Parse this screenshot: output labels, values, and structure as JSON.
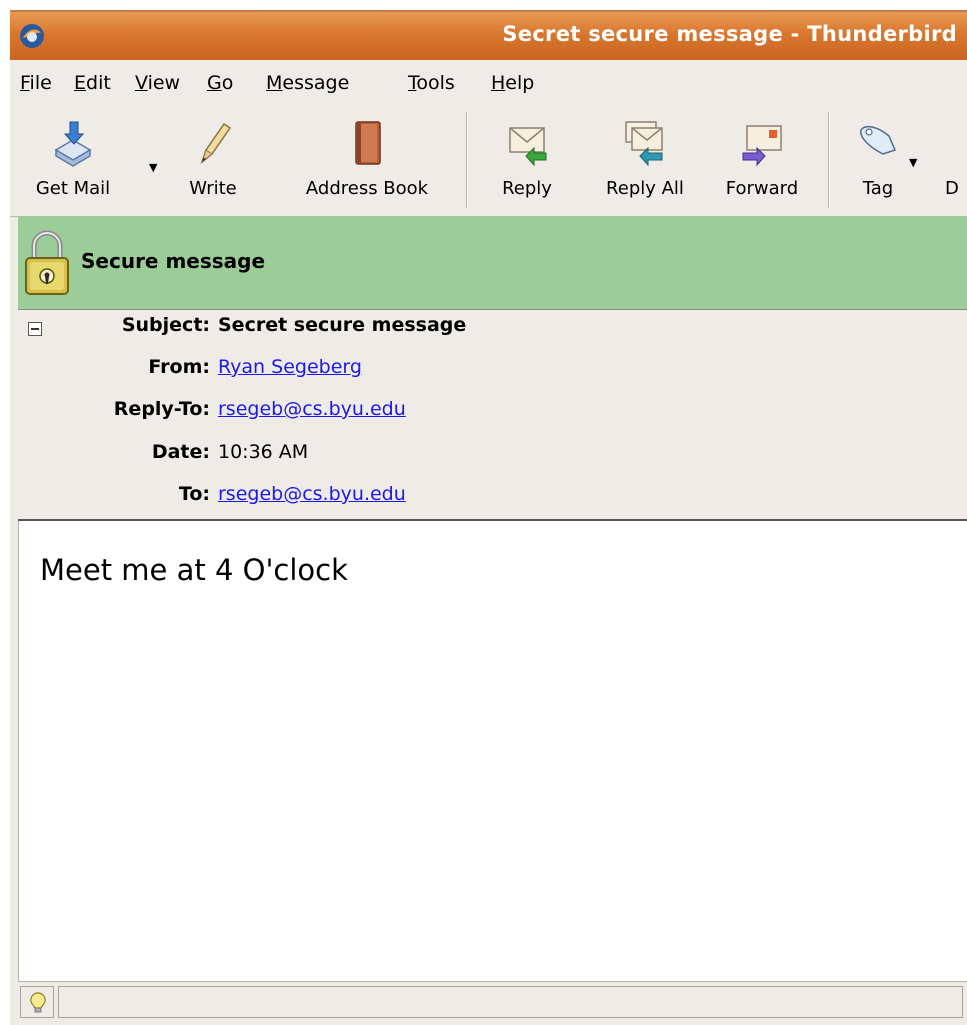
{
  "window": {
    "title": "Secret secure message - Thunderbird"
  },
  "menubar": {
    "items": [
      {
        "key": "F",
        "rest": "ile"
      },
      {
        "key": "E",
        "rest": "dit"
      },
      {
        "key": "V",
        "rest": "iew"
      },
      {
        "key": "G",
        "rest": "o"
      },
      {
        "key": "M",
        "rest": "essage"
      },
      {
        "key": "T",
        "rest": "ools"
      },
      {
        "key": "H",
        "rest": "elp"
      }
    ]
  },
  "toolbar": {
    "get_mail": "Get Mail",
    "write": "Write",
    "address_book": "Address Book",
    "reply": "Reply",
    "reply_all": "Reply All",
    "forward": "Forward",
    "tag": "Tag",
    "delete_partial": "D"
  },
  "security": {
    "label": "Secure message",
    "color": "#9ccc98"
  },
  "headers": {
    "subject_label": "Subject:",
    "subject": "Secret secure message",
    "from_label": "From:",
    "from": "Ryan Segeberg",
    "reply_to_label": "Reply-To:",
    "reply_to": "rsegeb@cs.byu.edu",
    "date_label": "Date:",
    "date": "10:36 AM",
    "to_label": "To:",
    "to": "rsegeb@cs.byu.edu"
  },
  "message": {
    "body": "Meet me at 4 O'clock"
  },
  "icons": {
    "app": "thunderbird-icon",
    "get_mail": "get-mail-icon",
    "write": "pencil-icon",
    "address_book": "address-book-icon",
    "reply": "reply-icon",
    "reply_all": "reply-all-icon",
    "forward": "forward-icon",
    "tag": "tag-icon",
    "secure": "padlock-icon",
    "status": "lightbulb-icon"
  }
}
